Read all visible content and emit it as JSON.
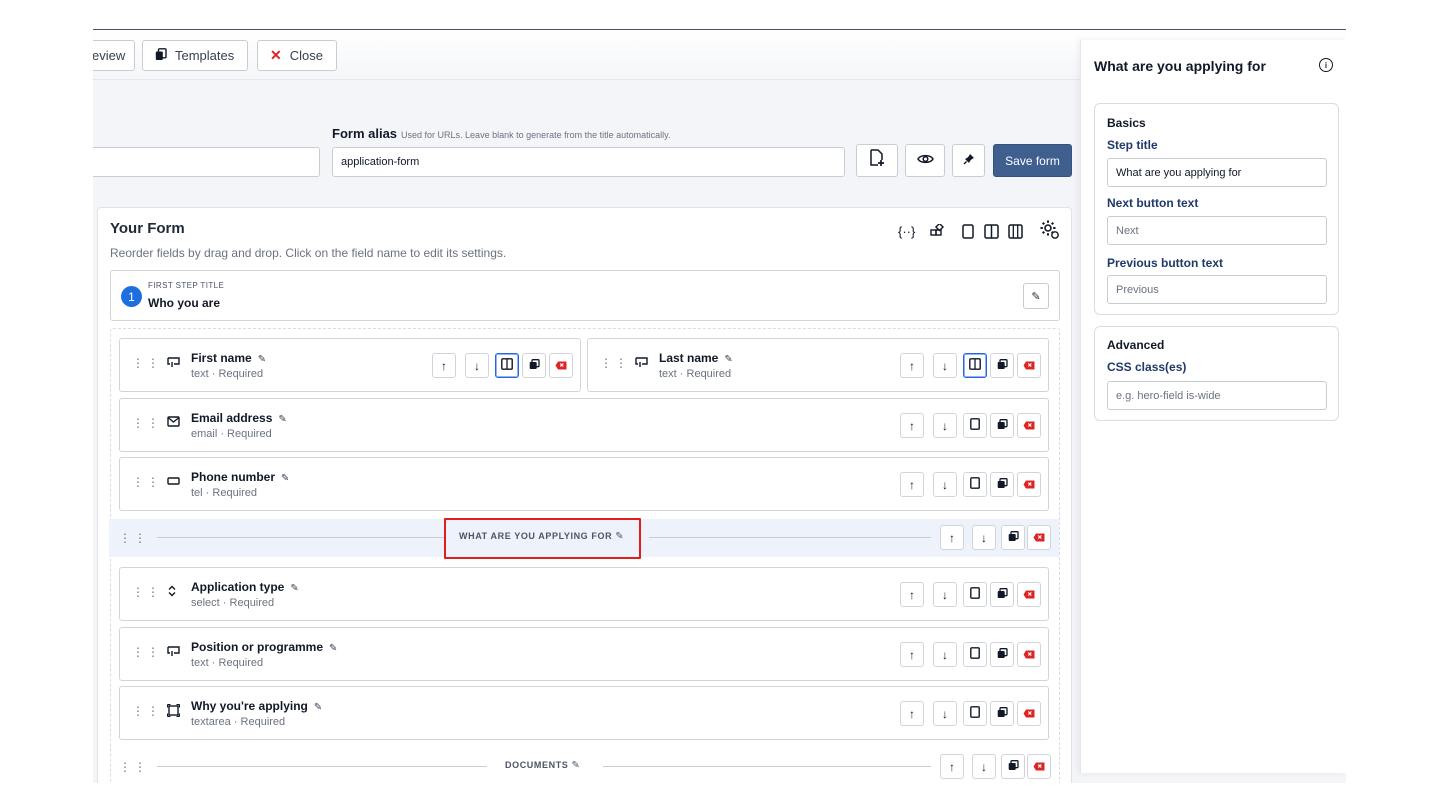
{
  "topbar": {
    "preview_label": "eview",
    "templates_label": "Templates",
    "close_label": "Close"
  },
  "alias": {
    "label": "Form alias",
    "hint": "Used for URLs. Leave blank to generate from the title automatically.",
    "value": "application-form",
    "title_value": ""
  },
  "actions": {
    "save_label": "Save form"
  },
  "form": {
    "title": "Your Form",
    "subtitle": "Reorder fields by drag and drop. Click on the field name to edit its settings.",
    "first_step": {
      "number": "1",
      "kicker": "FIRST STEP TITLE",
      "name": "Who you are"
    },
    "fields": [
      {
        "name": "First name",
        "meta": "text · Required",
        "icon": "textbox-icon"
      },
      {
        "name": "Last name",
        "meta": "text · Required",
        "icon": "textbox-icon"
      },
      {
        "name": "Email address",
        "meta": "email · Required",
        "icon": "envelope-icon"
      },
      {
        "name": "Phone number",
        "meta": "tel · Required",
        "icon": "input-icon"
      },
      {
        "name": "Application type",
        "meta": "select · Required",
        "icon": "select-icon"
      },
      {
        "name": "Position or programme",
        "meta": "text · Required",
        "icon": "textbox-icon"
      },
      {
        "name": "Why you're applying",
        "meta": "textarea · Required",
        "icon": "textarea-icon"
      }
    ],
    "separators": [
      {
        "label": "WHAT ARE YOU APPLYING FOR"
      },
      {
        "label": "DOCUMENTS"
      }
    ]
  },
  "panel": {
    "title": "What are you applying for",
    "basics": {
      "heading": "Basics",
      "step_title_label": "Step title",
      "step_title_value": "What are you applying for",
      "next_label": "Next button text",
      "next_placeholder": "Next",
      "prev_label": "Previous button text",
      "prev_placeholder": "Previous"
    },
    "advanced": {
      "heading": "Advanced",
      "css_label": "CSS class(es)",
      "css_placeholder": "e.g. hero-field is-wide"
    }
  },
  "colors": {
    "accent": "#3f5f8f",
    "step_badge": "#1d6fe0",
    "delete": "#dc2626",
    "highlight": "#e11d1d"
  }
}
